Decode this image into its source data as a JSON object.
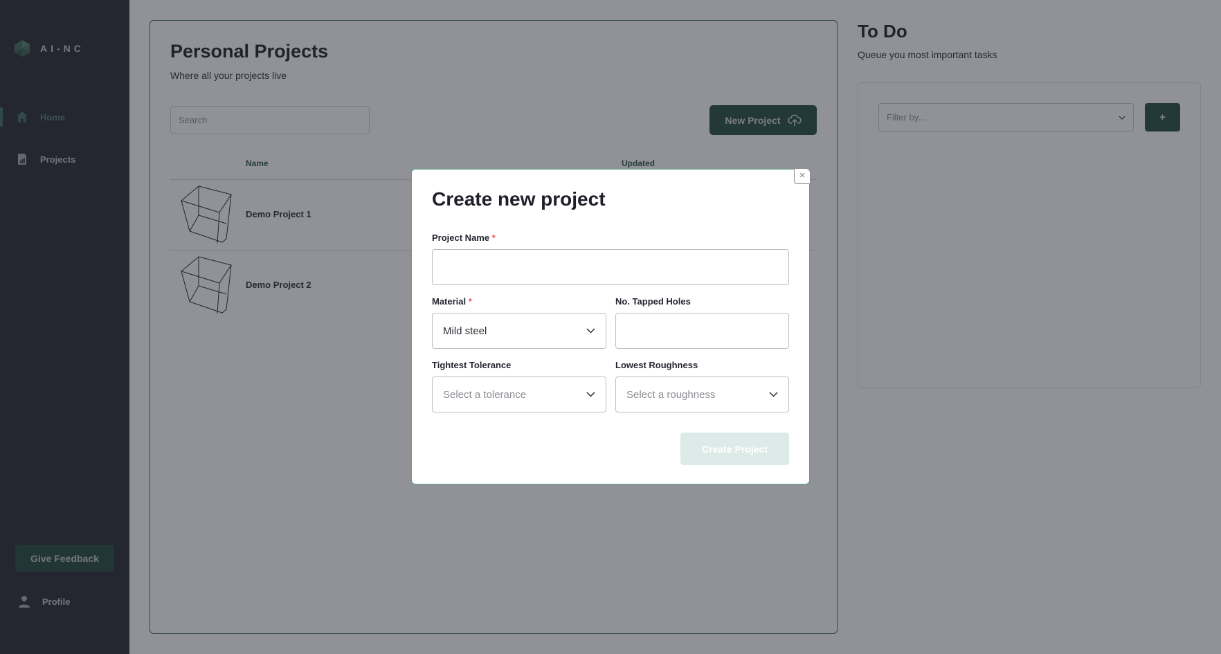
{
  "brand": {
    "name": "AI-NC",
    "accent": "#234a40"
  },
  "sidebar": {
    "items": [
      {
        "label": "Home",
        "icon": "home-icon",
        "active": true
      },
      {
        "label": "Projects",
        "icon": "document-chart-icon",
        "active": false
      }
    ],
    "feedback_label": "Give Feedback",
    "profile_label": "Profile"
  },
  "projects": {
    "title": "Personal Projects",
    "subtitle": "Where all your projects live",
    "search_placeholder": "Search",
    "new_project_label": "New Project",
    "columns": [
      "Name",
      "Updated"
    ],
    "rows": [
      {
        "name": "Demo Project 1",
        "updated": ""
      },
      {
        "name": "Demo Project 2",
        "updated": ""
      }
    ]
  },
  "todo": {
    "title": "To Do",
    "subtitle": "Queue you most important tasks",
    "filter_placeholder": "Filter by...",
    "add_label": "+"
  },
  "modal": {
    "title": "Create new project",
    "close_label": "×",
    "required_mark": "*",
    "fields": {
      "project_name": {
        "label": "Project Name",
        "value": ""
      },
      "material": {
        "label": "Material",
        "value": "Mild steel"
      },
      "tapped_holes": {
        "label": "No. Tapped Holes",
        "value": ""
      },
      "tolerance": {
        "label": "Tightest Tolerance",
        "placeholder": "Select a tolerance"
      },
      "roughness": {
        "label": "Lowest Roughness",
        "placeholder": "Select a roughness"
      }
    },
    "submit_label": "Create Project"
  }
}
